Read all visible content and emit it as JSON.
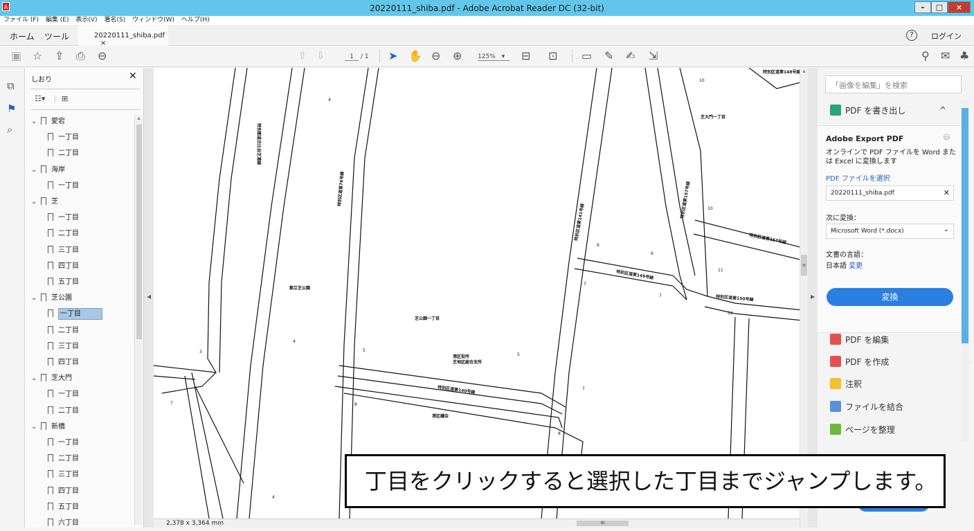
{
  "window": {
    "title": "20220111_shiba.pdf - Adobe Acrobat Reader DC (32-bit)",
    "app_icon": "acrobat-icon",
    "min": "–",
    "max": "□",
    "close": "×"
  },
  "menu": [
    "ファイル (F)",
    "編集 (E)",
    "表示(V)",
    "署名(S)",
    "ウィンドウ(W)",
    "ヘルプ(H)"
  ],
  "tabs": {
    "home": "ホーム",
    "tools": "ツール",
    "doc": "20220111_shiba.pdf",
    "close": "×",
    "help": "?",
    "login": "ログイン"
  },
  "toolbar": {
    "page_current": "1",
    "page_total": "/ 1",
    "zoom": "125%",
    "zoom_arrow": "▾"
  },
  "bookmarks": {
    "header": "しおり",
    "close": "✕",
    "items": [
      {
        "label": "愛宕",
        "level": 0
      },
      {
        "label": "一丁目",
        "level": 1
      },
      {
        "label": "二丁目",
        "level": 1
      },
      {
        "label": "海岸",
        "level": 0
      },
      {
        "label": "一丁目",
        "level": 1
      },
      {
        "label": "芝",
        "level": 0
      },
      {
        "label": "一丁目",
        "level": 1
      },
      {
        "label": "二丁目",
        "level": 1
      },
      {
        "label": "三丁目",
        "level": 1
      },
      {
        "label": "四丁目",
        "level": 1
      },
      {
        "label": "五丁目",
        "level": 1
      },
      {
        "label": "芝公園",
        "level": 0
      },
      {
        "label": "一丁目",
        "level": 1,
        "selected": true
      },
      {
        "label": "二丁目",
        "level": 1
      },
      {
        "label": "三丁目",
        "level": 1
      },
      {
        "label": "四丁目",
        "level": 1
      },
      {
        "label": "芝大門",
        "level": 0
      },
      {
        "label": "一丁目",
        "level": 1
      },
      {
        "label": "二丁目",
        "level": 1
      },
      {
        "label": "新橋",
        "level": 0
      },
      {
        "label": "一丁目",
        "level": 1
      },
      {
        "label": "二丁目",
        "level": 1
      },
      {
        "label": "三丁目",
        "level": 1
      },
      {
        "label": "四丁目",
        "level": 1
      },
      {
        "label": "五丁目",
        "level": 1
      },
      {
        "label": "六丁目",
        "level": 1
      }
    ]
  },
  "map_labels": {
    "shiba_koen": "芝公園一丁目",
    "shiba_daimon": "芝大門一丁目",
    "road_140": "特別区道第140号線",
    "road_149": "特別区道第149号線",
    "road_157": "特別区道第157号線",
    "road_150": "特別区道第150号線",
    "road_157b": "特別区道第157号線",
    "road_76": "特別区道第76号線",
    "road_141": "特別区道第141号線",
    "road_tokubetsu": "特別都道日比谷芝浦線",
    "road_top": "特別区道第148号線",
    "park": "都立芝公園",
    "office": "港区役所",
    "office2": "芝地区総合支所",
    "hall": "港区議会",
    "n1": "4",
    "n2": "3",
    "n3": "4",
    "n4": "5",
    "n5": "5",
    "n6": "7",
    "n7": "7",
    "n8": "6",
    "n9": "7",
    "n10": "6",
    "n11": "10",
    "n12": "10",
    "n13": "11",
    "n14": "12",
    "n15": "8",
    "n16": "8",
    "n17": "7",
    "n18": "4"
  },
  "status": {
    "size": "2,378 x 3,364 mm",
    "scroll_mark": "III"
  },
  "right_panel": {
    "search_placeholder": "「画像を編集」を検索",
    "export_title": "PDF を書き出し",
    "export_caret": "^",
    "service": "Adobe Export PDF",
    "desc": "オンラインで PDF ファイルを Word または Excel に変換します",
    "select_link": "PDF ファイルを選択",
    "file": "20220111_shiba.pdf",
    "file_remove": "✕",
    "convert_to_label": "次に変換：",
    "convert_to": "Microsoft Word (*.docx)",
    "lang_label": "文書の言語：",
    "lang": "日本語",
    "lang_change": "変更",
    "convert_btn": "変換",
    "tools": [
      "PDF を編集",
      "PDF を作成",
      "注釈",
      "ファイルを結合",
      "ページを整理"
    ],
    "expand": "⌄"
  },
  "callout": "丁目をクリックすると選択した丁目までジャンプします。",
  "colors": {
    "titlebar": "#62c6ea",
    "accent": "#2b7fe0",
    "selection": "#a9c6e3"
  }
}
